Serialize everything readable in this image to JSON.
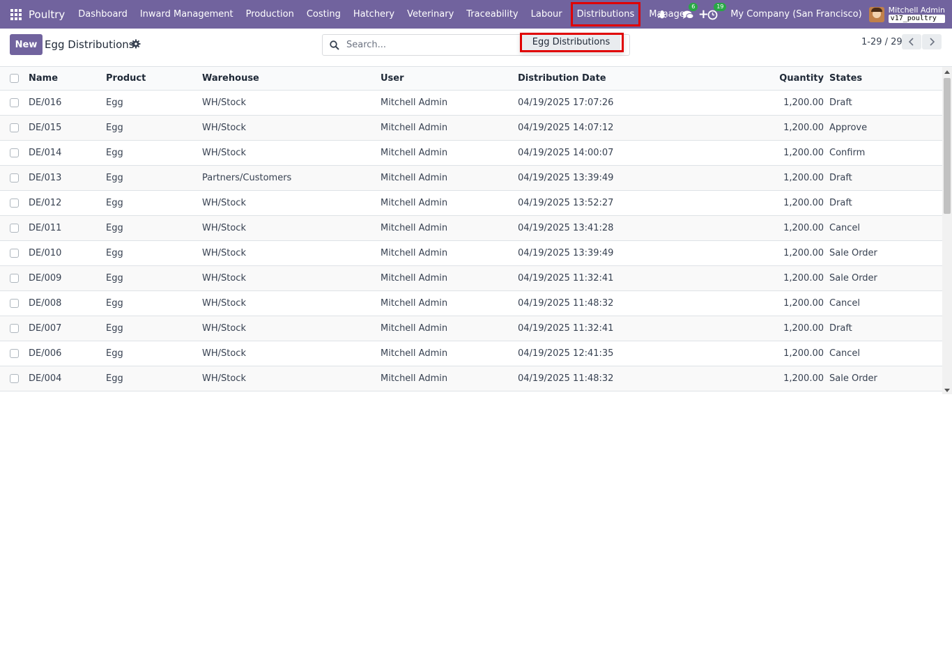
{
  "navbar": {
    "brand": "Poultry",
    "items": [
      "Dashboard",
      "Inward Management",
      "Production",
      "Costing",
      "Hatchery",
      "Veterinary",
      "Traceability",
      "Labour",
      "Distributions",
      "Manage"
    ],
    "plus": "+",
    "messages_count": "6",
    "activities_count": "19",
    "company": "My Company (San Francisco)",
    "user_name": "Mitchell Admin",
    "db_name": "v17_poultry"
  },
  "control": {
    "new_label": "New",
    "title": "Egg Distributions",
    "search_placeholder": "Search...",
    "pager": "1-29 / 29"
  },
  "dropdown": {
    "items": [
      "Egg Distributions"
    ]
  },
  "table": {
    "columns": [
      "Name",
      "Product",
      "Warehouse",
      "User",
      "Distribution Date",
      "Quantity",
      "States"
    ],
    "rows": [
      [
        "DE/016",
        "Egg",
        "WH/Stock",
        "Mitchell Admin",
        "04/19/2025 17:07:26",
        "1,200.00",
        "Draft"
      ],
      [
        "DE/015",
        "Egg",
        "WH/Stock",
        "Mitchell Admin",
        "04/19/2025 14:07:12",
        "1,200.00",
        "Approve"
      ],
      [
        "DE/014",
        "Egg",
        "WH/Stock",
        "Mitchell Admin",
        "04/19/2025 14:00:07",
        "1,200.00",
        "Confirm"
      ],
      [
        "DE/013",
        "Egg",
        "Partners/Customers",
        "Mitchell Admin",
        "04/19/2025 13:39:49",
        "1,200.00",
        "Draft"
      ],
      [
        "DE/012",
        "Egg",
        "WH/Stock",
        "Mitchell Admin",
        "04/19/2025 13:52:27",
        "1,200.00",
        "Draft"
      ],
      [
        "DE/011",
        "Egg",
        "WH/Stock",
        "Mitchell Admin",
        "04/19/2025 13:41:28",
        "1,200.00",
        "Cancel"
      ],
      [
        "DE/010",
        "Egg",
        "WH/Stock",
        "Mitchell Admin",
        "04/19/2025 13:39:49",
        "1,200.00",
        "Sale Order"
      ],
      [
        "DE/009",
        "Egg",
        "WH/Stock",
        "Mitchell Admin",
        "04/19/2025 11:32:41",
        "1,200.00",
        "Sale Order"
      ],
      [
        "DE/008",
        "Egg",
        "WH/Stock",
        "Mitchell Admin",
        "04/19/2025 11:48:32",
        "1,200.00",
        "Cancel"
      ],
      [
        "DE/007",
        "Egg",
        "WH/Stock",
        "Mitchell Admin",
        "04/19/2025 11:32:41",
        "1,200.00",
        "Draft"
      ],
      [
        "DE/006",
        "Egg",
        "WH/Stock",
        "Mitchell Admin",
        "04/19/2025 12:41:35",
        "1,200.00",
        "Cancel"
      ],
      [
        "DE/004",
        "Egg",
        "WH/Stock",
        "Mitchell Admin",
        "04/19/2025 11:48:32",
        "1,200.00",
        "Sale Order"
      ]
    ]
  },
  "colors": {
    "navbar": "#71639e",
    "primary_button": "#71639e",
    "highlight": "#e00000",
    "badge": "#28a745"
  },
  "icons": {
    "apps": "apps-grid-icon",
    "bug": "bug-icon",
    "messages": "chat-icon",
    "activities": "clock-icon",
    "settings": "gear-icon",
    "search": "search-icon",
    "prev": "chevron-left-icon",
    "next": "chevron-right-icon"
  }
}
